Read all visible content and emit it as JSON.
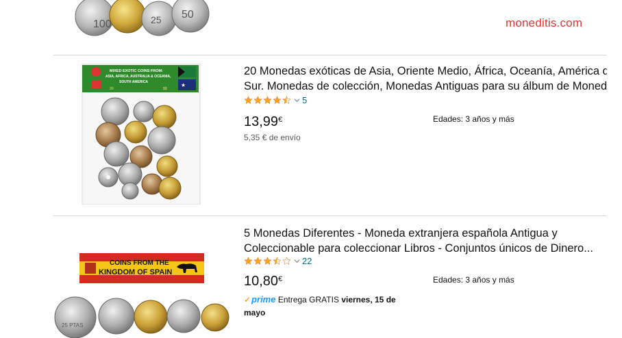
{
  "watermark": "moneditis.com",
  "products": [
    {
      "title_line1": "20 Monedas exóticas de Asia, Oriente Medio, África, Oceanía, América del",
      "title_line2": "Sur. Monedas de colección, Monedas Antiguas para su álbum de Moneda...",
      "rating": 4.5,
      "review_count": "5",
      "price": "13,99",
      "currency": "€",
      "shipping": "5,35 € de envío",
      "ages": "Edades: 3 años y más",
      "image_banner_text": "MIXED EXOTIC COINS FROM: ASIA, AFRICA, AUSTRALIA & OCEANIA, SOUTH AMERICA",
      "image_banner_numbers": [
        "20",
        "$$"
      ]
    },
    {
      "title_line1": "5 Monedas Diferentes - Moneda extranjera española Antigua y",
      "title_line2": "Coleccionable para coleccionar Libros - Conjuntos únicos de Dinero...",
      "rating": 3.5,
      "review_count": "22",
      "price": "10,80",
      "currency": "€",
      "ages": "Edades: 3 años y más",
      "prime_label": "prime",
      "delivery_text": "Entrega GRATIS",
      "delivery_day": "viernes, 15 de mayo",
      "image_banner_text": [
        "COINS FROM THE",
        "KINGDOM OF SPAIN"
      ],
      "image_coin_text": "25 PTAS"
    }
  ],
  "colors": {
    "star": "#ffa41c",
    "link": "#007185",
    "prime": "#1a98ff",
    "watermark": "#e3342f",
    "divider": "#d5d9d9"
  }
}
